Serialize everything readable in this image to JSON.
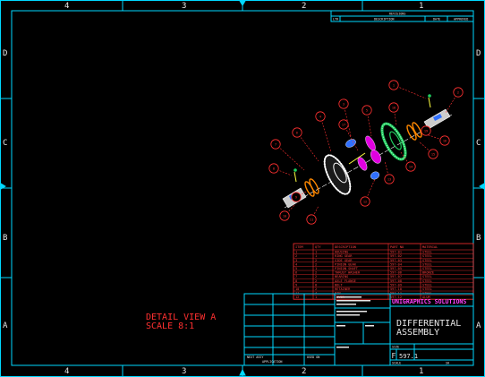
{
  "drawing": {
    "zones_top": [
      "4",
      "3",
      "2",
      "1"
    ],
    "zones_side": [
      "D",
      "C",
      "B",
      "A"
    ],
    "revisions_title": "REVISIONS",
    "revisions_headers": [
      "LTR",
      "DESCRIPTION",
      "DATE",
      "APPROVED"
    ],
    "detail_view_line1": "DETAIL VIEW A",
    "detail_view_line2": "SCALE 8:1",
    "company_name": "UNIGRAPHICS SOLUTIONS",
    "title_line1": "DIFFERENTIAL",
    "title_line2": "ASSEMBLY",
    "size_label": "SIZE",
    "size_value": "F",
    "dwg_no": "597.1",
    "scale_label": "SCALE",
    "sheet_label": "SH",
    "next_assy_label": "NEXT ASSY",
    "used_on_label": "USED ON",
    "application_label": "APPLICATION"
  },
  "bom": {
    "headers": [
      "ITEM",
      "QTY",
      "DESCRIPTION",
      "PART NO",
      "MATERIAL"
    ],
    "rows": [
      [
        "1",
        "1",
        "HOUSING",
        "597-01",
        "STEEL"
      ],
      [
        "2",
        "1",
        "RING GEAR",
        "597-02",
        "STEEL"
      ],
      [
        "3",
        "2",
        "SIDE GEAR",
        "597-03",
        "STEEL"
      ],
      [
        "4",
        "2",
        "PINION GEAR",
        "597-04",
        "STEEL"
      ],
      [
        "5",
        "1",
        "PINION SHAFT",
        "597-05",
        "STEEL"
      ],
      [
        "6",
        "2",
        "THRUST WASHER",
        "597-06",
        "BRONZE"
      ],
      [
        "7",
        "2",
        "BEARING",
        "597-07",
        "STEEL"
      ],
      [
        "8",
        "2",
        "AXLE FLANGE",
        "597-08",
        "STEEL"
      ],
      [
        "9",
        "8",
        "BOLT",
        "597-09",
        "STEEL"
      ],
      [
        "10",
        "2",
        "RETAINER",
        "597-10",
        "STEEL"
      ],
      [
        "11",
        "4",
        "PIN",
        "597-11",
        "STEEL"
      ],
      [
        "12",
        "1",
        "COVER",
        "597-12",
        "ALUM"
      ]
    ]
  },
  "callouts": [
    "1",
    "2",
    "3",
    "4",
    "5",
    "6",
    "7",
    "8",
    "9",
    "10",
    "11",
    "12",
    "13",
    "14",
    "15",
    "16",
    "17",
    "18",
    "19"
  ],
  "colors": {
    "border": "#00d8ff",
    "text": "#e8e8e8",
    "bom": "#ff3030",
    "title_magenta": "#ff40ff",
    "gear_green": "#20d060",
    "gear_magenta": "#e000e0",
    "gear_blue": "#3070ff"
  }
}
